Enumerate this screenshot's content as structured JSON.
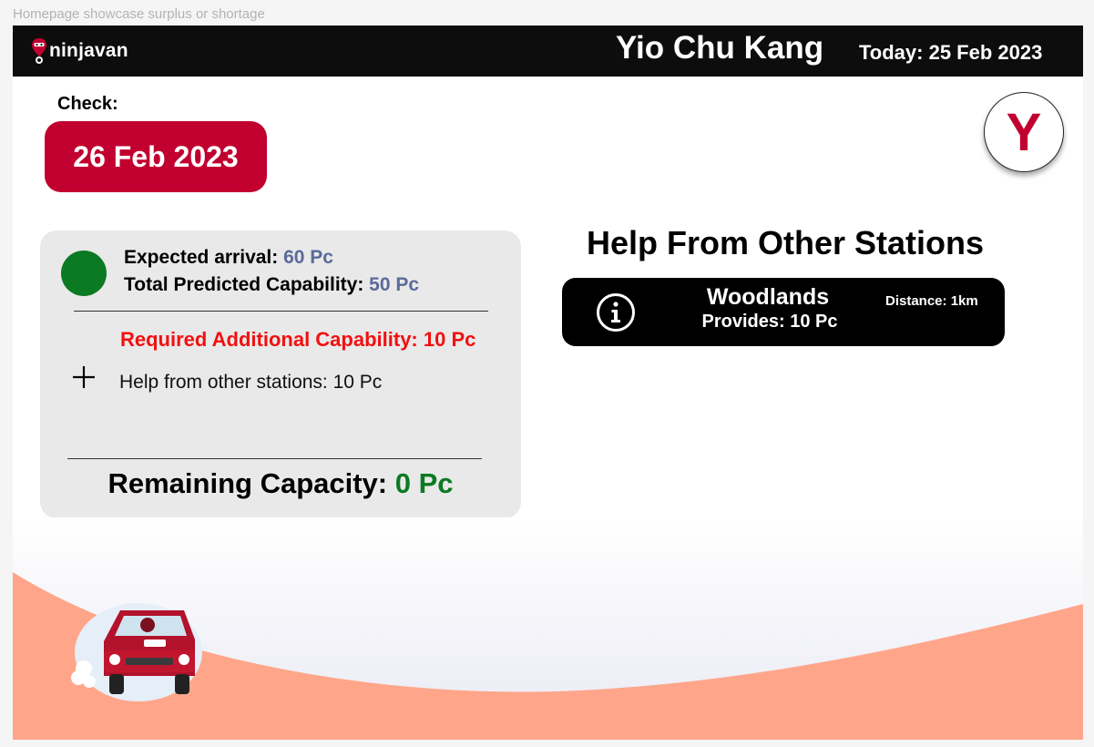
{
  "frame": {
    "label": "Homepage showcase surplus or shortage"
  },
  "header": {
    "logo_text": "ninjavan",
    "station_name": "Yio Chu Kang",
    "today_label": "Today: 25 Feb 2023"
  },
  "check": {
    "label": "Check:",
    "date": "26 Feb 2023"
  },
  "avatar": {
    "initial": "Y"
  },
  "summary": {
    "expected_label": "Expected arrival:",
    "expected_value": "60 Pc",
    "predicted_label": "Total Predicted Capability:",
    "predicted_value": "50 Pc",
    "required_text": "Required Additional Capability: 10 Pc",
    "help_text": "Help from other stations: 10 Pc",
    "remaining_label": "Remaining Capacity:",
    "remaining_value": "0 Pc",
    "status_color": "#0b7a22"
  },
  "help_panel": {
    "title": "Help From Other Stations",
    "stations": [
      {
        "name": "Woodlands",
        "provides": "Provides: 10 Pc",
        "distance": "Distance: 1km"
      }
    ]
  },
  "colors": {
    "brand_red": "#c20030",
    "alert_red": "#f21010",
    "value_blue": "#5b6a99",
    "ok_green": "#0b7a22",
    "wave_salmon": "#ffa68a"
  },
  "icons": [
    "ninjavan-logo-icon",
    "info-icon",
    "plus-icon",
    "delivery-van-illustration"
  ]
}
